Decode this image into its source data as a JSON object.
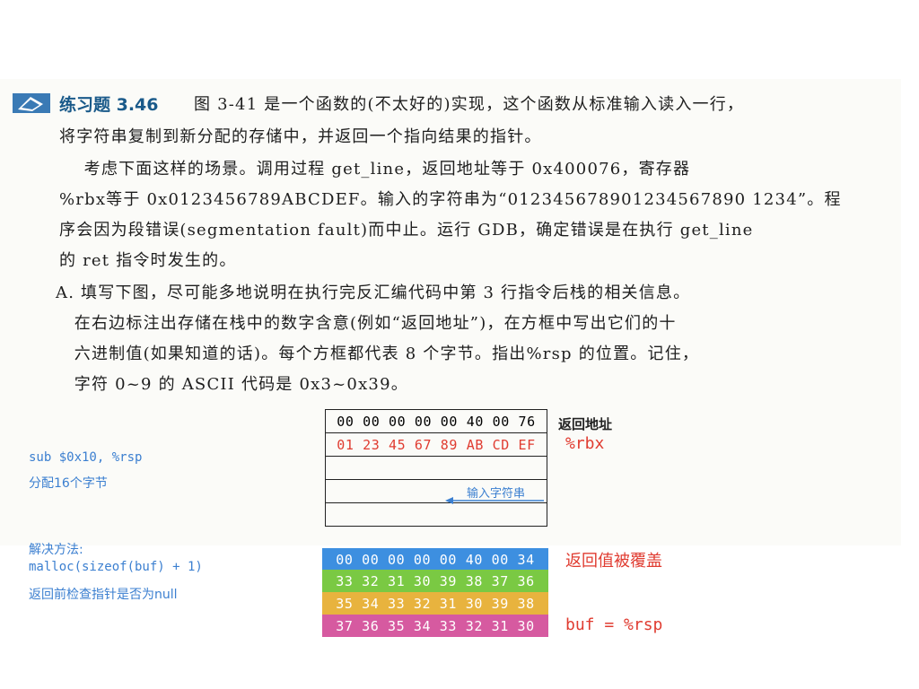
{
  "exercise": {
    "title": "练习题 3.46",
    "lines": [
      "图 3-41 是一个函数的(不太好的)实现，这个函数从标准输入读入一行，",
      "将字符串复制到新分配的存储中，并返回一个指向结果的指针。",
      "    考虑下面这样的场景。调用过程 get_line，返回地址等于 0x400076，寄存器",
      "%rbx等于 0x0123456789ABCDEF。输入的字符串为“012345678901234567890 1234”。程",
      "序会因为段错误(segmentation fault)而中止。运行 GDB，确定错误是在执行 get_line",
      "的 ret 指令时发生的。",
      "A. 填写下图，尽可能多地说明在执行完反汇编代码中第 3 行指令后栈的相关信息。",
      "   在右边标注出存储在栈中的数字含意(例如“返回地址”)，在方框中写出它们的十",
      "   六进制值(如果知道的话)。每个方框都代表 8 个字节。指出%rsp 的位置。记住，",
      "   字符 0~9 的 ASCII 代码是 0x3~0x39。"
    ]
  },
  "stack": {
    "rows": [
      "00 00 00 00 00 40 00 76",
      "01 23 45 67 89 AB CD EF",
      "",
      "",
      ""
    ],
    "label_return": "返回地址",
    "label_rbx": "%rbx",
    "arrow_label": "输入字符串"
  },
  "notes": {
    "sub": "sub $0x10, %rsp",
    "alloc": "分配16个字节",
    "solution_title": "解决方法:",
    "malloc": "malloc(sizeof(buf) + 1)",
    "check": "返回前检查指针是否为null"
  },
  "overflow": {
    "rows": [
      "00 00 00 00 00 40 00 34",
      "33 32 31 30 39 38 37 36",
      "35 34 33 32 31 30 39 38",
      "37 36 35 34 33 32 31 30"
    ],
    "colors": [
      "#3d8fe0",
      "#7ac943",
      "#e8b33e",
      "#d65aa0"
    ],
    "label_overwritten": "返回值被覆盖",
    "label_buf": "buf = %rsp"
  }
}
